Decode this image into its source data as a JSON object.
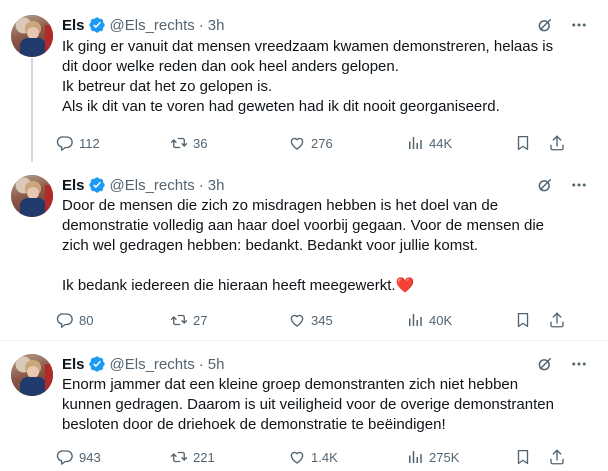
{
  "tweets": [
    {
      "name": "Els",
      "handle": "@Els_rechts",
      "separator": "·",
      "time": "3h",
      "lines": [
        "Ik ging er vanuit dat mensen vreedzaam kwamen demonstreren, helaas is",
        "dit door welke reden dan ook  heel anders gelopen.",
        "Ik betreur dat het zo gelopen is.",
        "Als ik dit van te voren had geweten had ik dit nooit georganiseerd."
      ],
      "replies": "112",
      "retweets": "36",
      "likes": "276",
      "views": "44K"
    },
    {
      "name": "Els",
      "handle": "@Els_rechts",
      "separator": "·",
      "time": "3h",
      "lines": [
        "Door de mensen die zich zo misdragen hebben is het doel van de",
        "demonstratie volledig aan haar doel voorbij gegaan. Voor de mensen die",
        "zich wel gedragen hebben: bedankt. Bedankt voor jullie komst.",
        "",
        "Ik bedank iedereen die hieraan heeft meegewerkt."
      ],
      "emoji": "❤️",
      "replies": "80",
      "retweets": "27",
      "likes": "345",
      "views": "40K"
    },
    {
      "name": "Els",
      "handle": "@Els_rechts",
      "separator": "·",
      "time": "5h",
      "lines": [
        "Enorm jammer dat een kleine groep demonstranten zich niet hebben",
        "kunnen gedragen. Daarom is uit veiligheid voor de overige demonstranten",
        "besloten door de driehoek de demonstratie te beëindigen!"
      ],
      "replies": "943",
      "retweets": "221",
      "likes": "1.4K",
      "views": "275K"
    }
  ],
  "colors": {
    "text": "#0f1419",
    "secondary": "#536471",
    "verified": "#1d9bf0",
    "divider": "#eff3f4",
    "heart": "#f91880"
  },
  "icons": [
    "verified-icon",
    "grok-icon",
    "more-icon",
    "reply-icon",
    "retweet-icon",
    "like-icon",
    "views-icon",
    "bookmark-icon",
    "share-icon"
  ]
}
